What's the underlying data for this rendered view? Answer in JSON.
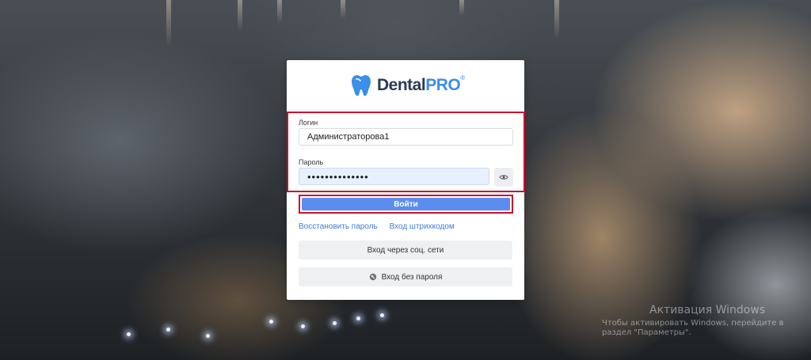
{
  "brand": {
    "name_part1": "Dental",
    "name_part2": "PRO",
    "registered_mark": "®"
  },
  "form": {
    "login_label": "Логин",
    "login_value": "Администраторова1",
    "password_label": "Пароль",
    "password_value": "••••••••••••••",
    "submit_label": "Войти"
  },
  "links": {
    "restore_password": "Восстановить пароль",
    "barcode_login": "Вход штрихкодом"
  },
  "buttons": {
    "social_login": "Вход через соц. сети",
    "passwordless_login": "Вход без пароля"
  },
  "watermark": {
    "title": "Активация Windows",
    "subtitle": "Чтобы активировать Windows, перейдите в раздел \"Параметры\"."
  },
  "colors": {
    "accent": "#5b8def",
    "highlight": "#c8102e",
    "link": "#3b7ddd",
    "brand_blue": "#3b8fe8"
  },
  "icons": [
    "tooth-logo-icon",
    "eye-icon",
    "key-icon"
  ]
}
